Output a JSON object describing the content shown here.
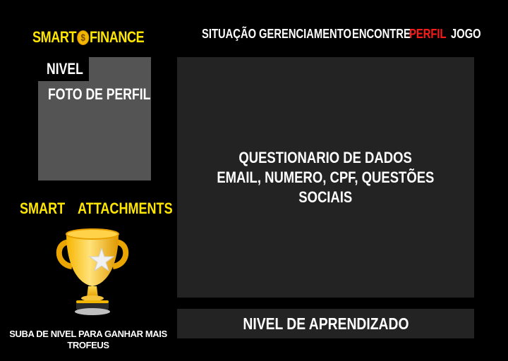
{
  "brand": {
    "name_left": "SMART",
    "coin_symbol": "$",
    "name_right": "FINANCE",
    "color": "#ffe600"
  },
  "nav": {
    "items": [
      {
        "label": "SITUAÇÃO"
      },
      {
        "label": "GERENCIAMENTO"
      },
      {
        "label": "ENCONTRE"
      },
      {
        "label": "PERFIL",
        "active": true
      },
      {
        "label": "JOGO"
      }
    ],
    "active_color": "#ff1a1a"
  },
  "profile": {
    "level_label": "NIVEL",
    "photo_label": "FOTO DE PERFIL"
  },
  "attachments": {
    "title_left": "SMART",
    "title_right": "ATTACHMENTS",
    "trophy_icon": "trophy-icon",
    "caption": "SUBA DE NIVEL PARA GANHAR MAIS TROFEUS"
  },
  "main": {
    "lines": [
      "QUESTIONARIO DE DADOS",
      "EMAIL, NUMERO, CPF, QUESTÕES",
      "SOCIAIS"
    ]
  },
  "learning": {
    "label": "NIVEL DE APRENDIZADO"
  }
}
